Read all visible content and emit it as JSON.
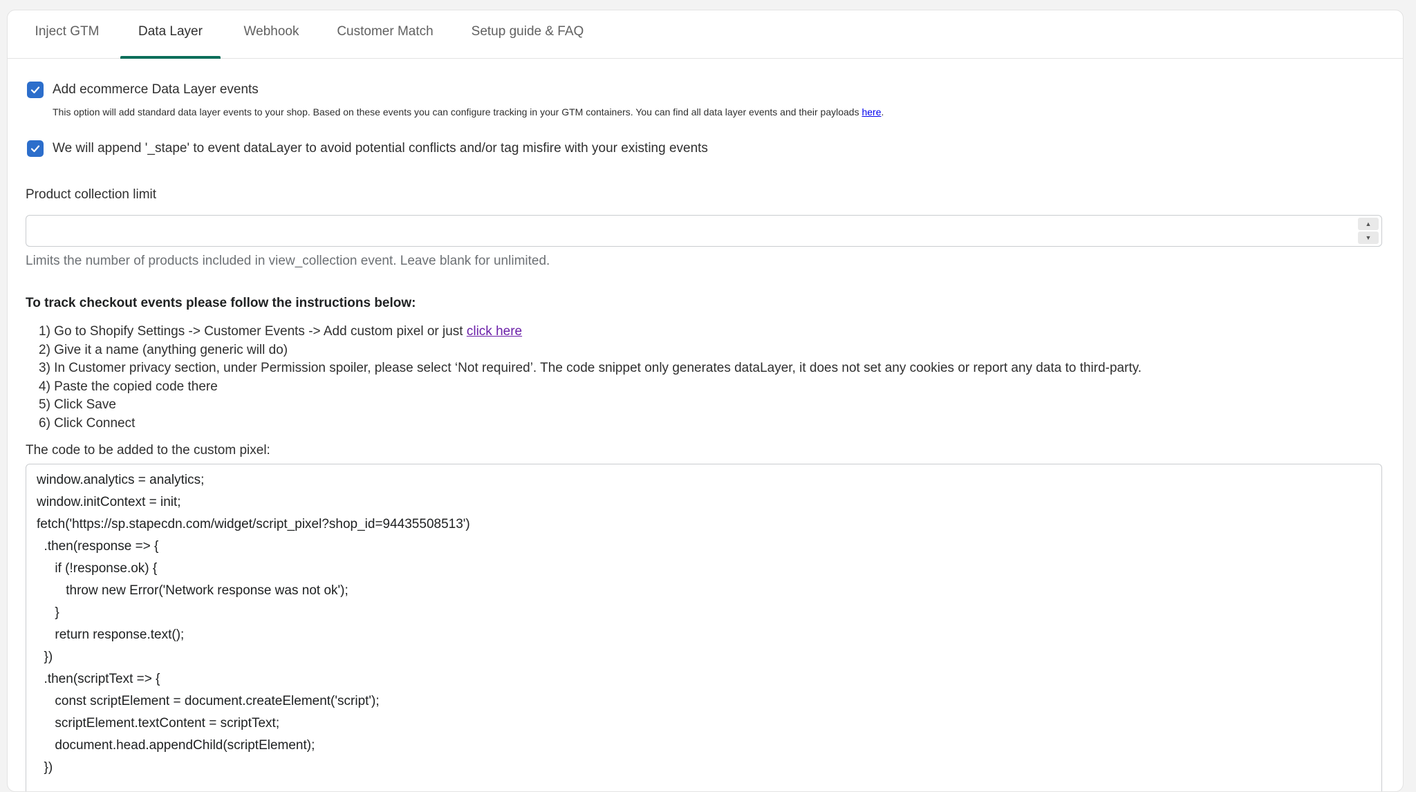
{
  "tabs": [
    {
      "label": "Inject GTM",
      "active": false
    },
    {
      "label": "Data Layer",
      "active": true
    },
    {
      "label": "Webhook",
      "active": false
    },
    {
      "label": "Customer Match",
      "active": false
    },
    {
      "label": "Setup guide & FAQ",
      "active": false
    }
  ],
  "accent_color": "#0a6e5a",
  "checkbox_color": "#2c6ecb",
  "options": {
    "ecommerce": {
      "checked": true,
      "label": "Add ecommerce Data Layer events",
      "help_prefix": "This option will add standard data layer events to your shop. Based on these events you can configure tracking in your GTM containers. You can find all data layer events and their payloads ",
      "help_link": "here",
      "help_suffix": "."
    },
    "append": {
      "checked": true,
      "label": "We will append '_stape' to event dataLayer to avoid potential conflicts and/or tag misfire with your existing events"
    }
  },
  "product_limit": {
    "label": "Product collection limit",
    "value": "",
    "help": "Limits the number of products included in view_collection event. Leave blank for unlimited."
  },
  "checkout": {
    "heading": "To track checkout events please follow the instructions below:",
    "step1_prefix": "1) Go to Shopify Settings -> Customer Events -> Add custom pixel or just ",
    "step1_link": "click here",
    "steps": [
      "2) Give it a name (anything generic will do)",
      "3) In Customer privacy section, under Permission spoiler, please select ‘Not required’. The code snippet only generates dataLayer, it does not set any cookies or report any data to third-party.",
      "4) Paste the copied code there",
      "5) Click Save",
      "6) Click Connect"
    ],
    "code_label": "The code to be added to the custom pixel:",
    "code_lines": [
      "window.analytics = analytics;",
      "window.initContext = init;",
      "fetch('https://sp.stapecdn.com/widget/script_pixel?shop_id=94435508513')",
      "  .then(response => {",
      "     if (!response.ok) {",
      "        throw new Error('Network response was not ok');",
      "     }",
      "     return response.text();",
      "  })",
      "  .then(scriptText => {",
      "     const scriptElement = document.createElement('script');",
      "     scriptElement.textContent = scriptText;",
      "     document.head.appendChild(scriptElement);",
      "  })"
    ]
  }
}
